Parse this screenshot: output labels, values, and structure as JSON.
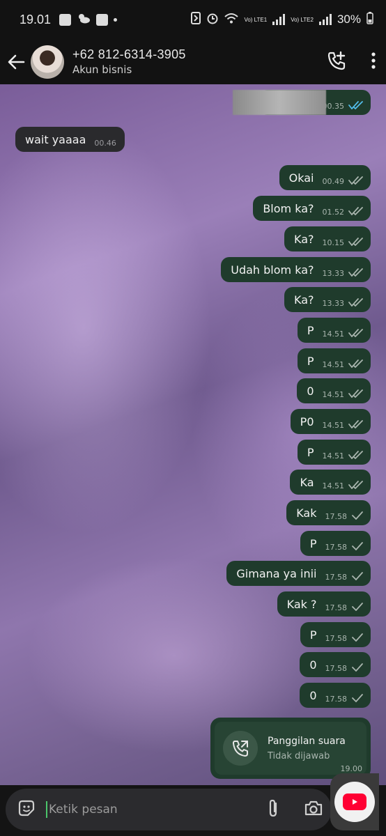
{
  "status_bar": {
    "time": "19.01",
    "net1": "Vo) LTE1",
    "net2": "Vo) LTE2",
    "battery": "30%",
    "icons": [
      "gallery-icon",
      "weather-icon",
      "ai-icon",
      "dot-icon",
      "nfc-icon",
      "alarm-icon",
      "wifi-icon",
      "signal-icon",
      "battery-icon"
    ]
  },
  "header": {
    "contact_name": "+62 812-6314-3905",
    "contact_sub": "Akun bisnis",
    "icons": [
      "back-arrow-icon",
      "avatar",
      "add-call-icon",
      "more-vert-icon"
    ]
  },
  "messages": [
    {
      "dir": "out",
      "text": "",
      "time": "00.35",
      "status": "read",
      "redacted": true
    },
    {
      "dir": "in",
      "text": "wait yaaaa",
      "time": "00.46"
    },
    {
      "dir": "out",
      "text": "Okai",
      "time": "00.49",
      "status": "delivered"
    },
    {
      "dir": "out",
      "text": "Blom ka?",
      "time": "01.52",
      "status": "delivered"
    },
    {
      "dir": "out",
      "text": "Ka?",
      "time": "10.15",
      "status": "delivered"
    },
    {
      "dir": "out",
      "text": "Udah blom ka?",
      "time": "13.33",
      "status": "delivered"
    },
    {
      "dir": "out",
      "text": "Ka?",
      "time": "13.33",
      "status": "delivered"
    },
    {
      "dir": "out",
      "text": "P",
      "time": "14.51",
      "status": "delivered"
    },
    {
      "dir": "out",
      "text": "P",
      "time": "14.51",
      "status": "delivered"
    },
    {
      "dir": "out",
      "text": "0",
      "time": "14.51",
      "status": "delivered"
    },
    {
      "dir": "out",
      "text": "P0",
      "time": "14.51",
      "status": "delivered"
    },
    {
      "dir": "out",
      "text": "P",
      "time": "14.51",
      "status": "delivered"
    },
    {
      "dir": "out",
      "text": "Ka",
      "time": "14.51",
      "status": "delivered"
    },
    {
      "dir": "out",
      "text": "Kak",
      "time": "17.58",
      "status": "sent"
    },
    {
      "dir": "out",
      "text": "P",
      "time": "17.58",
      "status": "sent"
    },
    {
      "dir": "out",
      "text": "Gimana ya inii",
      "time": "17.58",
      "status": "sent"
    },
    {
      "dir": "out",
      "text": "Kak ?",
      "time": "17.58",
      "status": "sent"
    },
    {
      "dir": "out",
      "text": "P",
      "time": "17.58",
      "status": "sent"
    },
    {
      "dir": "out",
      "text": "0",
      "time": "17.58",
      "status": "sent"
    },
    {
      "dir": "out",
      "text": "0",
      "time": "17.58",
      "status": "sent"
    }
  ],
  "call": {
    "title": "Panggilan suara",
    "subtitle": "Tidak dijawab",
    "time": "19.00",
    "icon": "missed-call-icon"
  },
  "composer": {
    "placeholder": "Ketik pesan",
    "icons": [
      "sticker-icon",
      "attach-icon",
      "camera-icon",
      "youtube-icon"
    ]
  },
  "colors": {
    "outgoing_bubble": "#1f3b2c",
    "incoming_bubble": "#2a2a2d",
    "read_tick": "#53bdeb",
    "tick": "#a9b5ae",
    "caret": "#4bc66b",
    "youtube": "#ff0033"
  }
}
